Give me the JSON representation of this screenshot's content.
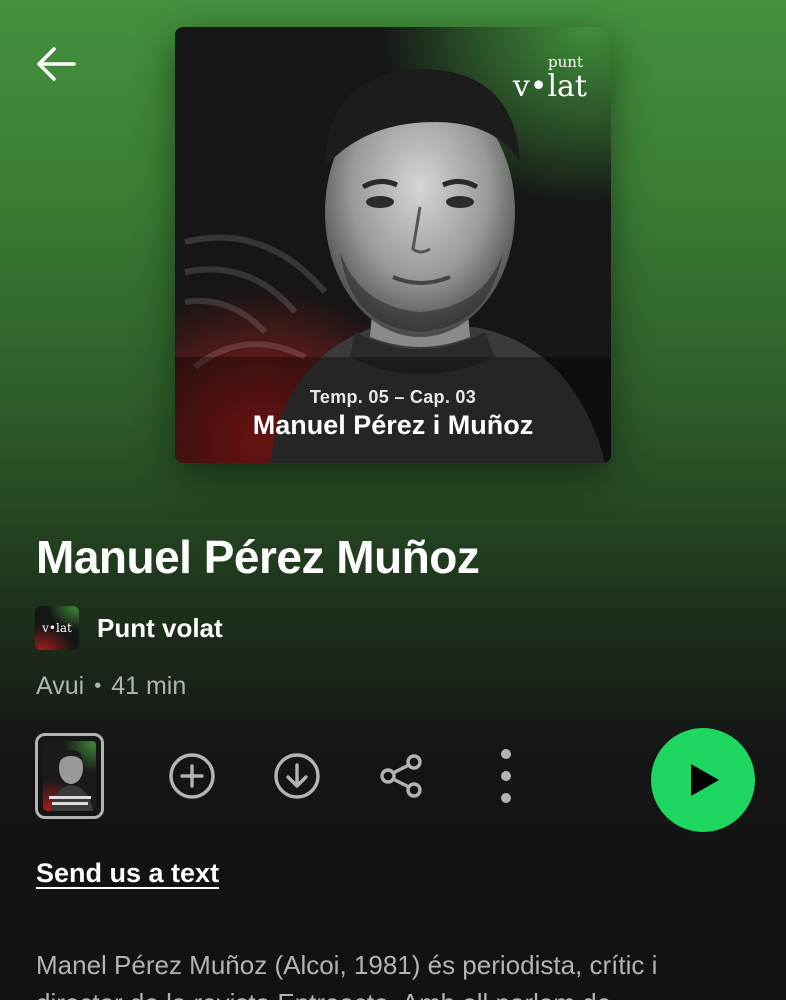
{
  "header": {
    "back_icon": "arrow-left-icon"
  },
  "cover": {
    "brand_top": "punt",
    "brand_main": "v•lat",
    "episode_code": "Temp. 05 – Cap. 03",
    "guest_name": "Manuel Pérez i Muñoz"
  },
  "episode": {
    "title": "Manuel Pérez Muñoz",
    "show_name": "Punt volat",
    "show_thumb_text": "v•lat",
    "date": "Avui",
    "separator": "•",
    "duration": "41 min",
    "send_text_link": "Send us a text",
    "description": "Manel Pérez Muñoz (Alcoi, 1981) és periodista, crític i director de la revista Entreacte. Amb ell parlem de"
  },
  "actions": {
    "icons": [
      "add-circle-icon",
      "download-circle-icon",
      "share-icon",
      "more-vertical-icon",
      "play-icon"
    ]
  },
  "colors": {
    "accent": "#1ed760",
    "background": "#121212",
    "gradient_top": "#43913d",
    "secondary_text": "#b3b3b3"
  }
}
